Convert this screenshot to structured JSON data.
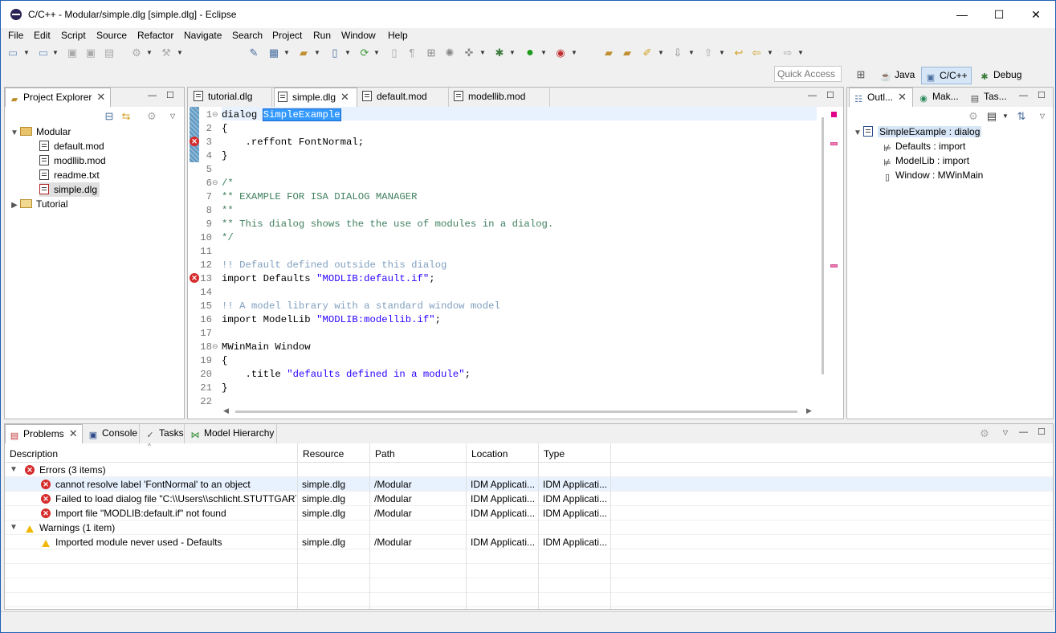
{
  "window": {
    "title": "C/C++ - Modular/simple.dlg [simple.dlg] - Eclipse",
    "minimize": "—",
    "maximize": "☐",
    "close": "✕"
  },
  "menu": [
    "File",
    "Edit",
    "Script",
    "Source",
    "Refactor",
    "Navigate",
    "Search",
    "Project",
    "Run",
    "Window",
    "Help"
  ],
  "toolbar": {
    "quick_access_placeholder": "Quick Access",
    "perspectives": [
      "Java",
      "C/C++",
      "Debug"
    ]
  },
  "project_explorer": {
    "tab_label": "Project Explorer",
    "tree": {
      "project": "Modular",
      "files": [
        "default.mod",
        "modllib.mod",
        "readme.txt",
        "simple.dlg"
      ],
      "other_project": "Tutorial"
    }
  },
  "editor": {
    "tabs": [
      "tutorial.dlg",
      "simple.dlg",
      "default.mod",
      "modellib.mod"
    ],
    "lines": [
      {
        "n": "1",
        "segments": [
          {
            "t": "dialog ",
            "c": "kw"
          },
          {
            "t": "SimpleExample",
            "c": "sel"
          }
        ]
      },
      {
        "n": "2",
        "segments": [
          {
            "t": "{",
            "c": "kw"
          }
        ]
      },
      {
        "n": "3",
        "segments": [
          {
            "t": "    .reffont FontNormal;",
            "c": "kw"
          }
        ]
      },
      {
        "n": "4",
        "segments": [
          {
            "t": "}",
            "c": "kw"
          }
        ]
      },
      {
        "n": "5",
        "segments": []
      },
      {
        "n": "6",
        "segments": [
          {
            "t": "/*",
            "c": "cmt"
          }
        ]
      },
      {
        "n": "7",
        "segments": [
          {
            "t": "** EXAMPLE FOR ISA DIALOG MANAGER",
            "c": "cmt"
          }
        ]
      },
      {
        "n": "8",
        "segments": [
          {
            "t": "**",
            "c": "cmt"
          }
        ]
      },
      {
        "n": "9",
        "segments": [
          {
            "t": "** This dialog shows the the use of modules in a dialog.",
            "c": "cmt"
          }
        ]
      },
      {
        "n": "10",
        "segments": [
          {
            "t": "*/",
            "c": "cmt"
          }
        ]
      },
      {
        "n": "11",
        "segments": []
      },
      {
        "n": "12",
        "segments": [
          {
            "t": "!! Default defined outside this dialog",
            "c": "cmt2"
          }
        ]
      },
      {
        "n": "13",
        "segments": [
          {
            "t": "import Defaults ",
            "c": "kw"
          },
          {
            "t": "\"MODLIB:default.if\"",
            "c": "str"
          },
          {
            "t": ";",
            "c": "kw"
          }
        ]
      },
      {
        "n": "14",
        "segments": []
      },
      {
        "n": "15",
        "segments": [
          {
            "t": "!! A model library with a standard window model",
            "c": "cmt2"
          }
        ]
      },
      {
        "n": "16",
        "segments": [
          {
            "t": "import ModelLib ",
            "c": "kw"
          },
          {
            "t": "\"MODLIB:modellib.if\"",
            "c": "str"
          },
          {
            "t": ";",
            "c": "kw"
          }
        ]
      },
      {
        "n": "17",
        "segments": []
      },
      {
        "n": "18",
        "segments": [
          {
            "t": "MWinMain Window",
            "c": "kw"
          }
        ]
      },
      {
        "n": "19",
        "segments": [
          {
            "t": "{",
            "c": "kw"
          }
        ]
      },
      {
        "n": "20",
        "segments": [
          {
            "t": "    .title ",
            "c": "kw"
          },
          {
            "t": "\"defaults defined in a module\"",
            "c": "str"
          },
          {
            "t": ";",
            "c": "kw"
          }
        ]
      },
      {
        "n": "21",
        "segments": [
          {
            "t": "}",
            "c": "kw"
          }
        ]
      },
      {
        "n": "22",
        "segments": []
      }
    ]
  },
  "outline": {
    "tabs": [
      "Outl...",
      "Mak...",
      "Tas..."
    ],
    "root": "SimpleExample : dialog",
    "children": [
      "Defaults : import",
      "ModelLib : import",
      "Window : MWinMain"
    ]
  },
  "problems": {
    "tabs": [
      "Problems",
      "Console",
      "Tasks",
      "Model Hierarchy"
    ],
    "columns": [
      "Description",
      "Resource",
      "Path",
      "Location",
      "Type"
    ],
    "groups": [
      {
        "label": "Errors (3 items)",
        "kind": "error",
        "items": [
          {
            "description": "cannot resolve label 'FontNormal' to an object",
            "resource": "simple.dlg",
            "path": "/Modular",
            "location": "IDM Applicati...",
            "type": "IDM Applicati..."
          },
          {
            "description": "Failed to load dialog file \"C:\\\\Users\\\\schlicht.STUTTGART\\",
            "resource": "simple.dlg",
            "path": "/Modular",
            "location": "IDM Applicati...",
            "type": "IDM Applicati..."
          },
          {
            "description": "Import file \"MODLIB:default.if\" not found",
            "resource": "simple.dlg",
            "path": "/Modular",
            "location": "IDM Applicati...",
            "type": "IDM Applicati..."
          }
        ]
      },
      {
        "label": "Warnings (1 item)",
        "kind": "warning",
        "items": [
          {
            "description": "Imported module never used - Defaults",
            "resource": "simple.dlg",
            "path": "/Modular",
            "location": "IDM Applicati...",
            "type": "IDM Applicati..."
          }
        ]
      }
    ]
  }
}
